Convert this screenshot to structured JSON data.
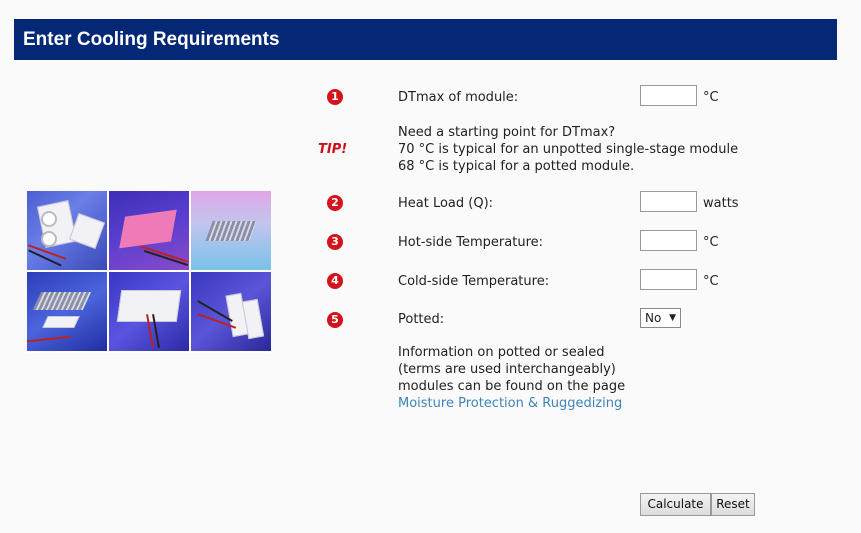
{
  "header": {
    "title": "Enter Cooling Requirements"
  },
  "steps": [
    {
      "number": "1",
      "label": "DTmax of module:",
      "value": "",
      "unit": "°C"
    },
    {
      "number": "2",
      "label": "Heat Load (Q):",
      "value": "",
      "unit": "watts"
    },
    {
      "number": "3",
      "label": "Hot-side Temperature:",
      "value": "",
      "unit": "°C"
    },
    {
      "number": "4",
      "label": "Cold-side Temperature:",
      "value": "",
      "unit": "°C"
    },
    {
      "number": "5",
      "label": "Potted:",
      "selected": "No"
    }
  ],
  "tip": {
    "badge": "TIP!",
    "lines": [
      "Need a starting point for DTmax?",
      "70 °C is typical for an unpotted single-stage module",
      "68 °C is typical for a potted module."
    ]
  },
  "potted_info": {
    "lines": [
      "Information on potted or sealed",
      "(terms are used interchangeably)",
      "modules can be found on the page"
    ],
    "link": "Moisture Protection & Ruggedizing"
  },
  "buttons": {
    "calculate": "Calculate",
    "reset": "Reset"
  },
  "colors": {
    "header_bg": "#042876",
    "badge_red": "#d4141c",
    "link": "#3f84b8"
  }
}
